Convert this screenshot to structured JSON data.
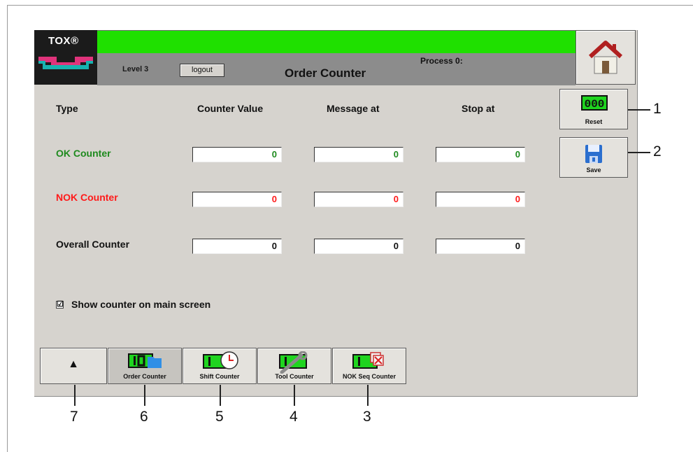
{
  "logo": {
    "text": "TOX®"
  },
  "header": {
    "level": "Level 3",
    "logout_label": "logout",
    "process": "Process 0:",
    "title": "Order Counter",
    "status_bar_color": "#1fe000"
  },
  "columns": {
    "type": "Type",
    "counter_value": "Counter Value",
    "message_at": "Message at",
    "stop_at": "Stop at"
  },
  "rows": [
    {
      "label": "OK Counter",
      "color": "#1e8a1e",
      "counter_value": "0",
      "message_at": "0",
      "stop_at": "0"
    },
    {
      "label": "NOK Counter",
      "color": "#ff1a1a",
      "counter_value": "0",
      "message_at": "0",
      "stop_at": "0"
    },
    {
      "label": "Overall Counter",
      "color": "#111111",
      "counter_value": "0",
      "message_at": "0",
      "stop_at": "0"
    }
  ],
  "side_buttons": {
    "reset_display": "000",
    "reset_label": "Reset",
    "save_label": "Save"
  },
  "show_counter": {
    "checked": true,
    "mark": "☑",
    "label": "Show counter on main screen"
  },
  "tabs": [
    {
      "label": "▲",
      "icon": "eject-icon"
    },
    {
      "label": "Order Counter",
      "icon": "order-counter-icon",
      "active": true
    },
    {
      "label": "Shift Counter",
      "icon": "shift-counter-icon"
    },
    {
      "label": "Tool Counter",
      "icon": "tool-counter-icon"
    },
    {
      "label": "NOK Seq Counter",
      "icon": "nok-seq-counter-icon"
    }
  ],
  "callouts": [
    "1",
    "2",
    "3",
    "4",
    "5",
    "6",
    "7"
  ]
}
